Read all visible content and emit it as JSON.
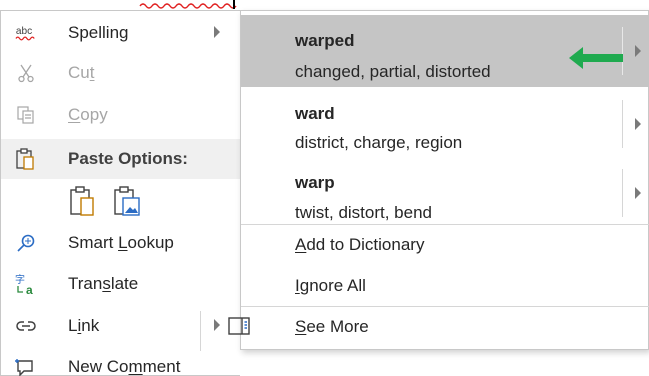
{
  "menu": {
    "spelling": {
      "label": "Spelling",
      "icon": "spell-check-icon",
      "icon_text": "abc"
    },
    "cut": {
      "label_pre": "Cu",
      "label_u": "t",
      "label_post": "",
      "icon": "scissors-icon",
      "enabled": false
    },
    "copy": {
      "label_pre": "",
      "label_u": "C",
      "label_post": "opy",
      "icon": "copy-icon",
      "enabled": false
    },
    "paste_options": {
      "label": "Paste Options:",
      "icon": "clipboard-icon"
    },
    "paste_buttons": [
      "keep-text-only-icon",
      "picture-icon"
    ],
    "smart_lookup": {
      "label_pre": "Smart ",
      "label_u": "L",
      "label_post": "ookup",
      "icon": "search-globe-icon"
    },
    "translate": {
      "label_pre": "Tran",
      "label_u": "s",
      "label_post": "late",
      "icon": "translate-icon"
    },
    "link": {
      "label_pre": "L",
      "label_u": "i",
      "label_post": "nk",
      "icon": "link-icon"
    },
    "new_comment": {
      "label_pre": "New Co",
      "label_u": "m",
      "label_post": "ment",
      "icon": "new-comment-icon"
    }
  },
  "submenu": {
    "suggestions": [
      {
        "word": "warped",
        "synonyms": "changed, partial, distorted",
        "highlighted": true
      },
      {
        "word": "ward",
        "synonyms": "district, charge, region",
        "highlighted": false
      },
      {
        "word": "warp",
        "synonyms": "twist, distort, bend",
        "highlighted": false
      }
    ],
    "add_to_dictionary": {
      "label_pre": "",
      "label_u": "A",
      "label_post": "dd to Dictionary"
    },
    "ignore_all": {
      "label_pre": "",
      "label_u": "I",
      "label_post": "gnore All"
    },
    "see_more": {
      "label_pre": "",
      "label_u": "S",
      "label_post": "ee More",
      "icon": "side-pane-icon"
    }
  },
  "colors": {
    "accent_green": "#1faa4f",
    "squiggle_red": "#e02020",
    "highlight": "#c5c5c5",
    "icon_blue": "#2b6cc4",
    "icon_orange": "#c07a00"
  }
}
